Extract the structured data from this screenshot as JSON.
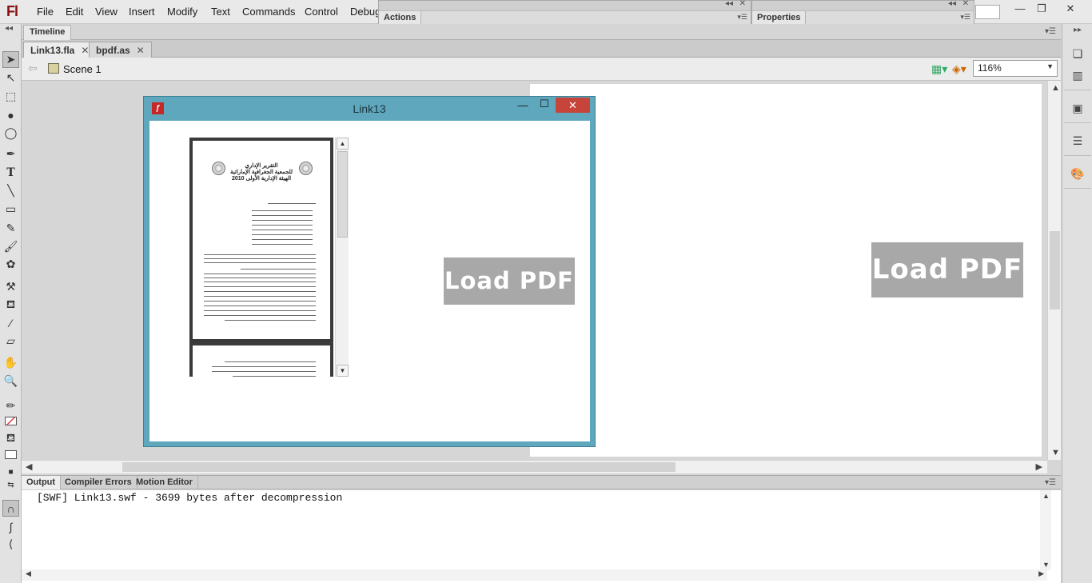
{
  "app": {
    "logo": "Fl"
  },
  "menu": [
    "File",
    "Edit",
    "View",
    "Insert",
    "Modify",
    "Text",
    "Commands",
    "Control",
    "Debug"
  ],
  "window_controls": {
    "minimize": "—",
    "restore": "❐",
    "close": "✕"
  },
  "floating_panels": {
    "actions": {
      "label": "Actions"
    },
    "properties": {
      "label": "Properties"
    }
  },
  "timeline": {
    "tab": "Timeline"
  },
  "documents": [
    {
      "label": "Link13.fla",
      "active": true
    },
    {
      "label": "bpdf.as",
      "active": false
    }
  ],
  "edit_bar": {
    "scene": "Scene 1",
    "zoom": "116%"
  },
  "stage": {
    "button_label": "Load PDF"
  },
  "player_window": {
    "title": "Link13",
    "button_label": "Load PDF",
    "close_glyph": "✕",
    "pdf": {
      "title_line1": "التقرير الإداري",
      "title_line2": "للجمعية الجغرافية الإماراتية",
      "title_line3": "الهيئة الإدارية الأولى 2010"
    }
  },
  "output": {
    "tabs": [
      "Output",
      "Compiler Errors",
      "Motion Editor"
    ],
    "text": "[SWF] Link13.swf - 3699 bytes after decompression"
  },
  "colors": {
    "player_frame": "#5fa7bd",
    "close_button": "#c7443a",
    "load_pdf_bg": "#a8a8a8"
  }
}
